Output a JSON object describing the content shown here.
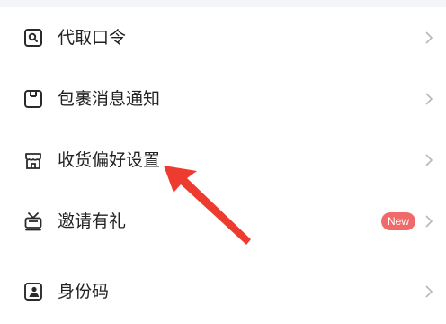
{
  "menu": {
    "items": [
      {
        "label": "代取口令",
        "icon": "search-code-icon"
      },
      {
        "label": "包裹消息通知",
        "icon": "package-icon"
      },
      {
        "label": "收货偏好设置",
        "icon": "store-icon"
      },
      {
        "label": "邀请有礼",
        "icon": "gift-tv-icon",
        "badge": "New"
      },
      {
        "label": "身份码",
        "icon": "id-portrait-icon"
      }
    ]
  },
  "colors": {
    "icon_stroke": "#2a2a2a",
    "chevron": "#b8b8b8",
    "badge_bg": "#f06a6a",
    "annotation_arrow": "#ee3b2f"
  }
}
